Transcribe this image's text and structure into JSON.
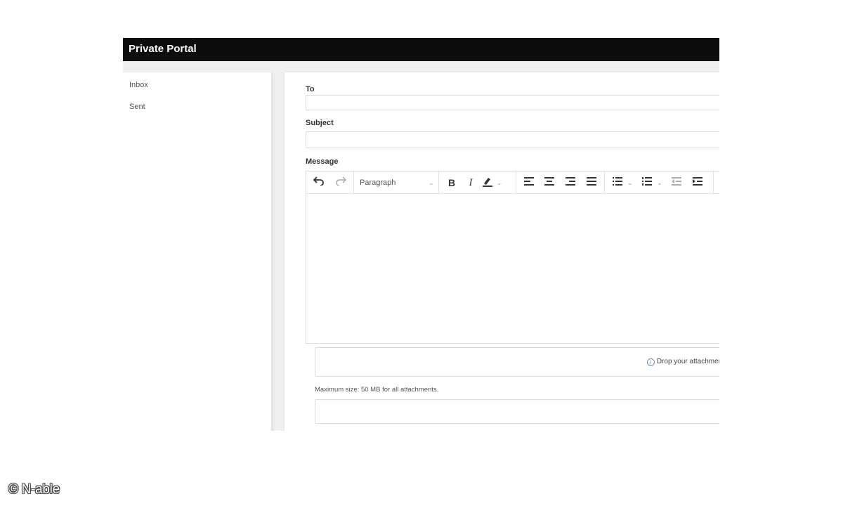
{
  "app": {
    "title": "Private Portal"
  },
  "sidebar": {
    "items": [
      {
        "label": "Inbox"
      },
      {
        "label": "Sent"
      }
    ]
  },
  "compose": {
    "to_label": "To",
    "to_value": "",
    "subject_label": "Subject",
    "subject_value": "",
    "message_label": "Message",
    "paragraph_format": "Paragraph",
    "toolbar_icons": [
      "undo-icon",
      "redo-icon",
      "bold-icon",
      "italic-icon",
      "highlight-icon",
      "align-left-icon",
      "align-center-icon",
      "align-right-icon",
      "align-justify-icon",
      "bullet-list-icon",
      "numbered-list-icon",
      "outdent-icon",
      "indent-icon"
    ],
    "drop_text": "Drop your attachments",
    "max_size_text": "Maximum size: 50 MB for all attachments."
  },
  "watermark": "© N-able"
}
